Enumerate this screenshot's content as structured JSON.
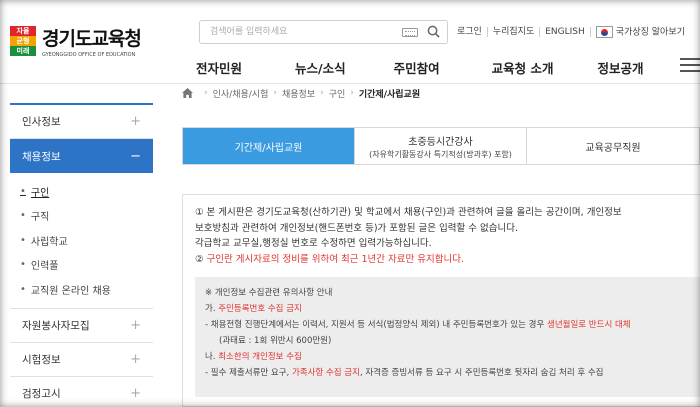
{
  "header": {
    "logo_badge": [
      "자율",
      "균형",
      "미래"
    ],
    "logo_title": "경기도교육청",
    "logo_sub": "GYEONGGIDO OFFICE OF EDUCATION",
    "search_placeholder": "검색어를 입력하세요",
    "util": [
      "로그인",
      "누리집지도",
      "ENGLISH",
      "국가상징 알아보기"
    ],
    "gnb": [
      "전자민원",
      "뉴스/소식",
      "주민참여",
      "교육청 소개",
      "정보공개"
    ]
  },
  "sidebar": {
    "items": [
      {
        "label": "인사정보",
        "toggle": "+"
      },
      {
        "label": "채용정보",
        "toggle": "−"
      }
    ],
    "sub_items": [
      "구인",
      "구직",
      "사립학교",
      "인력풀",
      "교직원 온라인 채용"
    ],
    "items_after": [
      {
        "label": "자원봉사자모집",
        "toggle": "+"
      },
      {
        "label": "시험정보",
        "toggle": "+"
      },
      {
        "label": "검정고시",
        "toggle": "+"
      }
    ]
  },
  "breadcrumb": [
    "인사/채용/시험",
    "채용정보",
    "구인",
    "기간제/사립교원"
  ],
  "tabs": [
    {
      "label": "기간제/사립교원",
      "sub": ""
    },
    {
      "label": "초중등시간강사",
      "sub": "(자유학기활동강사 특기적성(방과후) 포함)"
    },
    {
      "label": "교육공무직원",
      "sub": ""
    }
  ],
  "notice": {
    "line1": "① 본 게시판은 경기도교육청(산하기관) 및 학교에서 채용(구인)과 관련하여 글을 올리는 공간이며, 개인정보",
    "line2": "보호방침과 관련하여 개인정보(핸드폰번호 등)가 포함된 글은 입력할 수 없습니다.",
    "line3": "각급학교 교무실,행정실 번호로 수정하면 입력가능하십니다.",
    "line4_prefix": "② ",
    "line4_red": "구인란 게시자료의 정비를 위하여 최근 1년간 자료만 유지합니다."
  },
  "privacy": {
    "title": "※ 개인정보 수집관련 유의사항 안내",
    "a_prefix": "가. ",
    "a_red": "주민등록번호 수집 금지",
    "a_desc_1": "- 채용전형 진행단계에서는 이력서, 지원서 등 서식(법정양식 제외) 내 주민등록번호가 있는 경우 ",
    "a_desc_red": "생년월일로 반드시 대체",
    "a_fine": "(과태료 : 1회 위반시 600만원)",
    "b_prefix": "나. ",
    "b_red": "최소한의 개인정보 수집",
    "b_desc_1": "- 필수 제출서류만 요구, ",
    "b_desc_red": "가족사항 수집 금지",
    "b_desc_2": ", 자격증 증빙서류 등 요구 시 주민등록번호 뒷자리 숨김 처리 후 수집"
  },
  "colors": {
    "primary": "#2d73c6",
    "tab_active": "#3a9be0",
    "accent_red": "#e0342e"
  }
}
